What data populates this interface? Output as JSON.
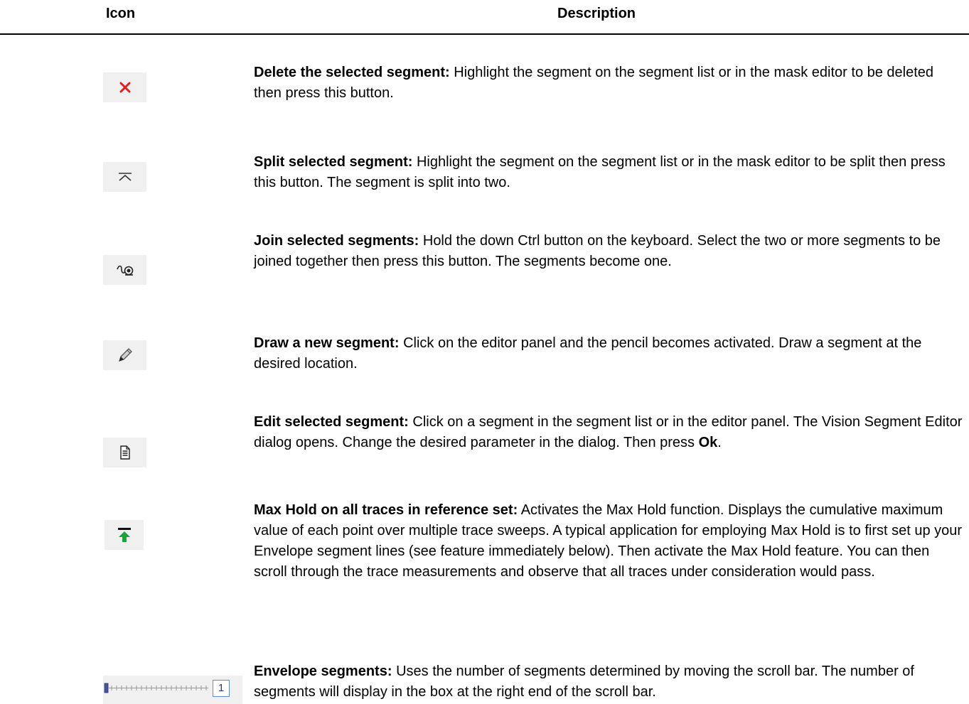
{
  "header": {
    "icon_col": "Icon",
    "desc_col": "Description"
  },
  "rows": [
    {
      "icon": "delete-x-icon",
      "title": "Delete the selected segment:",
      "text": " Highlight the segment on the segment list or in the mask editor to be deleted then press this button."
    },
    {
      "icon": "split-segment-icon",
      "title": "Split selected segment:",
      "text": " Highlight the segment on the segment list or in the mask editor to be split then press this button. The segment is split into two."
    },
    {
      "icon": "join-segments-icon",
      "title": "Join selected segments:",
      "text": " Hold the down Ctrl button on the keyboard. Select the two or more segments to be joined together then press this button. The segments become one."
    },
    {
      "icon": "pencil-icon",
      "title": "Draw a new segment:",
      "text": " Click on the editor panel and the pencil becomes activated. Draw a segment at the desired location."
    },
    {
      "icon": "edit-document-icon",
      "title": "Edit selected segment:",
      "text": " Click on a segment in the segment list or in the editor panel. The Vision Segment Editor dialog opens. Change the desired parameter in the dialog. Then press ",
      "text_bold_end": "Ok",
      "text_end": "."
    },
    {
      "icon": "max-hold-icon",
      "title": "Max Hold on all traces in reference set:",
      "text": " Activates the Max Hold function. Displays the cumulative maximum value of each point over multiple trace sweeps. A typical application for employing Max Hold is to first set up your Envelope segment lines (see feature immediately below). Then activate the Max Hold feature. You can then scroll through the trace measurements and observe that all traces under consideration would pass."
    },
    {
      "icon": "envelope-scrollbar-icon",
      "title": "Envelope segments:",
      "text": " Uses the number of segments determined by moving the scroll bar. The number of segments will display in the box at the right end of the scroll bar.",
      "value": "1"
    }
  ]
}
